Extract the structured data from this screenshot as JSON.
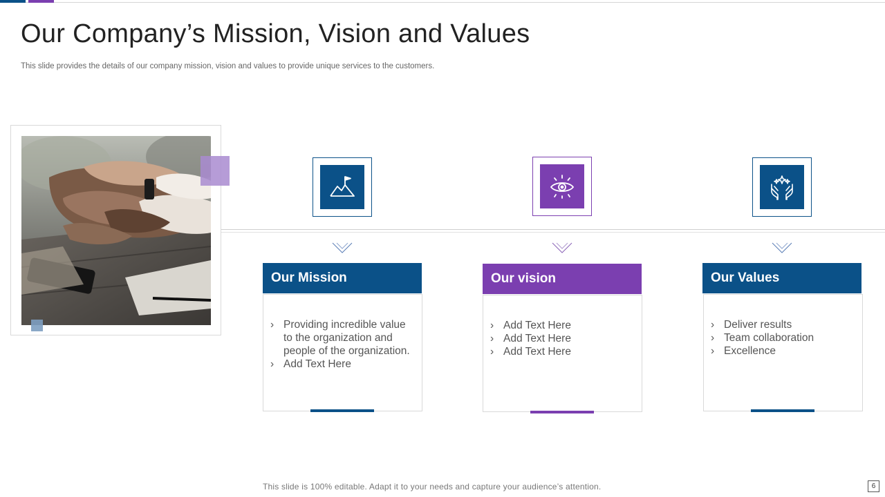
{
  "slide": {
    "title": "Our Company’s Mission, Vision and Values",
    "subtitle": "This slide provides the details of our company mission, vision and values to provide unique services to the customers.",
    "footer": "This slide is 100% editable. Adapt it to your needs and capture your audience’s attention.",
    "page_number": "6"
  },
  "colors": {
    "blue": "#0b5188",
    "purple": "#7b3fb0",
    "light_purple": "#a98bd0",
    "light_blue": "#7d9fc1"
  },
  "cards": [
    {
      "heading": "Our Mission",
      "icon": "mountain-flag-icon",
      "accent": "blue",
      "bullets": [
        "Providing incredible value to the organization and people of the organization.",
        "Add Text Here"
      ]
    },
    {
      "heading": "Our vision",
      "icon": "eye-icon",
      "accent": "purple",
      "bullets": [
        "Add Text Here",
        "Add Text Here",
        "Add Text Here"
      ]
    },
    {
      "heading": "Our Values",
      "icon": "hands-sparkle-icon",
      "accent": "blue",
      "bullets": [
        "Deliver results",
        "Team collaboration",
        "Excellence"
      ]
    }
  ],
  "bullet_glyph": "›",
  "photo": {
    "subject": "team-hands-stacked-photo"
  }
}
